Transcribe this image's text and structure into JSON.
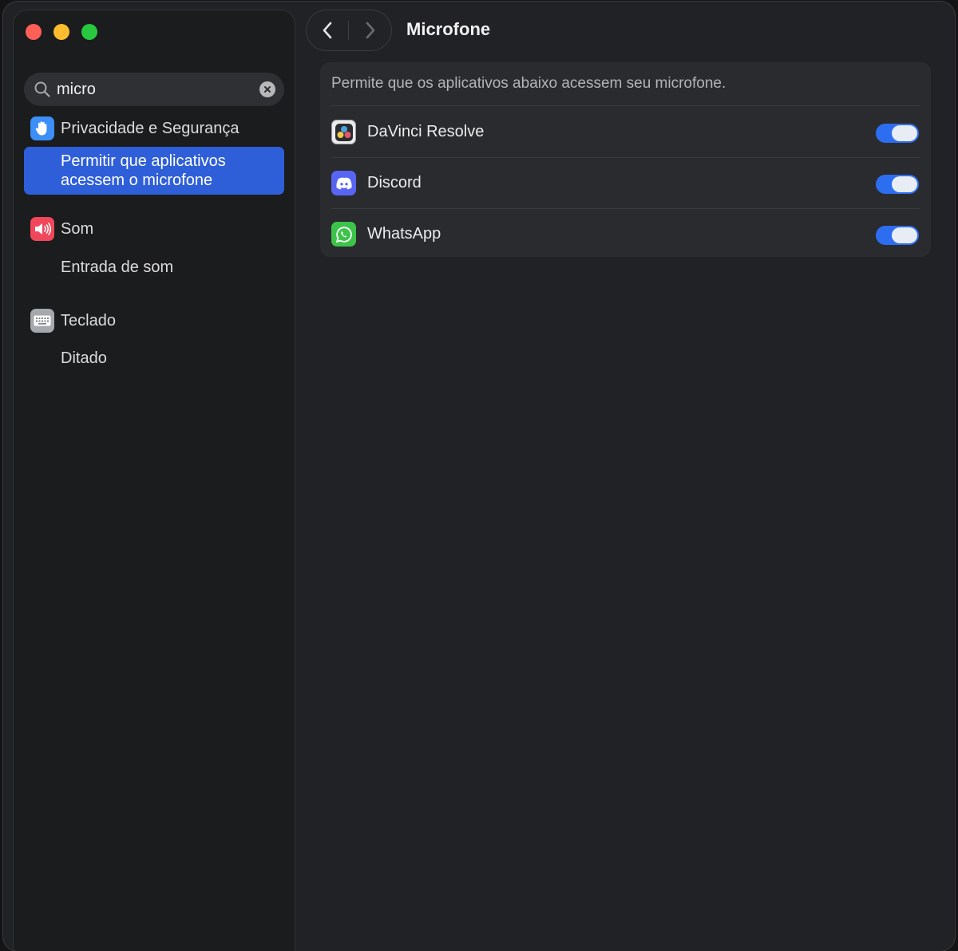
{
  "window": {
    "traffic_lights": [
      "close",
      "minimize",
      "zoom"
    ],
    "title": "Microfone"
  },
  "search": {
    "value": "micro",
    "icons": {
      "search": "magnifier-icon",
      "clear": "clear-x-icon"
    }
  },
  "sidebar": {
    "items": [
      {
        "label": "Privacidade e Segurança",
        "icon": "hand-raised-icon",
        "color": "#3d8ef7"
      },
      {
        "label": "Permitir que aplicativos acessem o microfone",
        "line1": "Permitir que aplicativos",
        "line2": "acessem o microfone",
        "selected": true
      },
      {
        "label": "Som",
        "icon": "speaker-icon",
        "color": "#f1475b"
      },
      {
        "label": "Entrada de som"
      },
      {
        "label": "Teclado",
        "icon": "keyboard-icon",
        "color": "#a7a8ad"
      },
      {
        "label": "Ditado"
      }
    ]
  },
  "main": {
    "description": "Permite que os aplicativos abaixo acessem seu microfone.",
    "apps": [
      {
        "name": "DaVinci Resolve",
        "icon": "davinci-resolve-icon",
        "enabled": true
      },
      {
        "name": "Discord",
        "icon": "discord-icon",
        "enabled": true
      },
      {
        "name": "WhatsApp",
        "icon": "whatsapp-icon",
        "enabled": true
      }
    ]
  },
  "colors": {
    "accent": "#2f5fd8",
    "toggle_on": "#2d6ef0",
    "window_bg": "#212225",
    "sidebar_bg": "#1b1c1e"
  }
}
